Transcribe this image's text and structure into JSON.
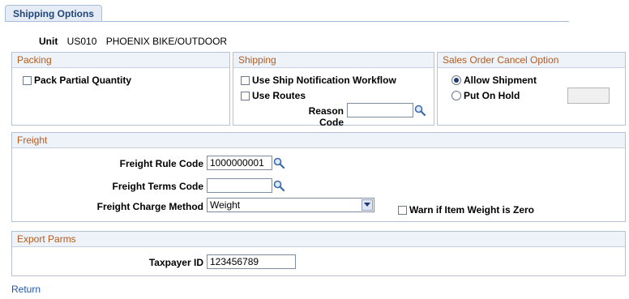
{
  "tab": {
    "label": "Shipping Options"
  },
  "unit": {
    "label": "Unit",
    "code": "US010",
    "name": "PHOENIX BIKE/OUTDOOR"
  },
  "packing": {
    "title": "Packing",
    "pack_partial_label": "Pack Partial Quantity",
    "pack_partial_checked": false
  },
  "shipping": {
    "title": "Shipping",
    "ship_notification_label": "Use Ship Notification Workflow",
    "ship_notification_checked": false,
    "use_routes_label": "Use Routes",
    "use_routes_checked": false,
    "reason_code_label": "Reason Code",
    "reason_code_value": ""
  },
  "sales_cancel": {
    "title": "Sales Order Cancel Option",
    "allow_shipment_label": "Allow Shipment",
    "put_on_hold_label": "Put On Hold",
    "selected": "Allow Shipment",
    "hold_value": ""
  },
  "freight": {
    "title": "Freight",
    "rule_code_label": "Freight Rule Code",
    "rule_code_value": "1000000001",
    "terms_code_label": "Freight Terms Code",
    "terms_code_value": "",
    "charge_method_label": "Freight Charge Method",
    "charge_method_value": "Weight",
    "warn_zero_label": "Warn if Item Weight is Zero",
    "warn_zero_checked": false
  },
  "export": {
    "title": "Export Parms",
    "taxpayer_label": "Taxpayer ID",
    "taxpayer_value": "123456789"
  },
  "footer": {
    "return_label": "Return"
  },
  "colors": {
    "group_title": "#b25b1c",
    "link": "#1f56a8",
    "header_bg": "#eef2f9",
    "tab_bg": "#e5ecf6"
  },
  "icons": {
    "lookup": "magnifier-icon",
    "dropdown": "chevron-down-icon"
  }
}
